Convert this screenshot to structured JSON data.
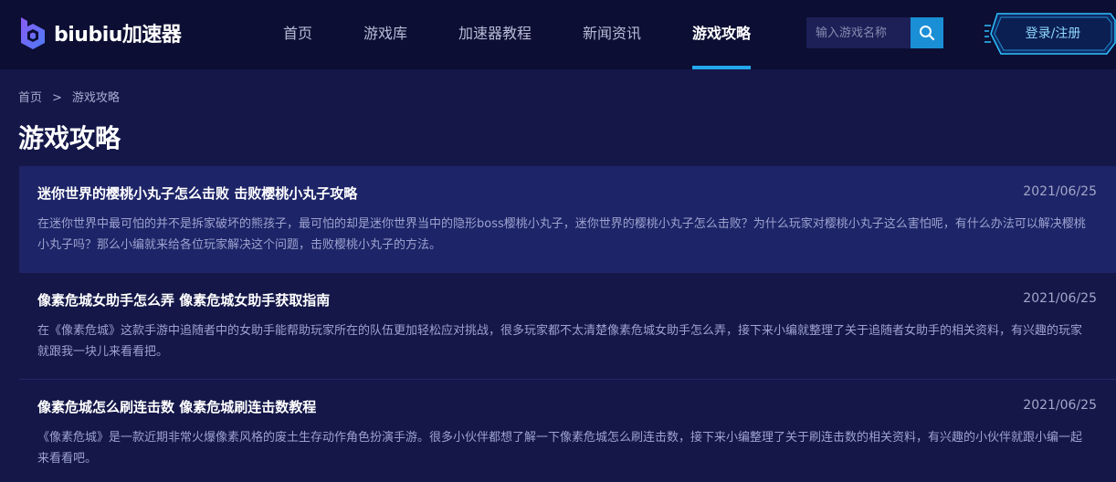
{
  "brand": {
    "logo_text": "biubiu加速器"
  },
  "nav": {
    "items": [
      {
        "label": "首页"
      },
      {
        "label": "游戏库"
      },
      {
        "label": "加速器教程"
      },
      {
        "label": "新闻资讯"
      },
      {
        "label": "游戏攻略",
        "active": true
      }
    ]
  },
  "search": {
    "placeholder": "输入游戏名称",
    "icon": "search-icon"
  },
  "auth": {
    "login_label": "登录/注册"
  },
  "breadcrumb": {
    "items": [
      "首页",
      "游戏攻略"
    ],
    "separator": ">"
  },
  "page": {
    "title": "游戏攻略"
  },
  "articles": [
    {
      "title": "迷你世界的樱桃小丸子怎么击败 击败樱桃小丸子攻略",
      "date": "2021/06/25",
      "summary": "在迷你世界中最可怕的并不是拆家破坏的熊孩子，最可怕的却是迷你世界当中的隐形boss樱桃小丸子，迷你世界的樱桃小丸子怎么击败？为什么玩家对樱桃小丸子这么害怕呢，有什么办法可以解决樱桃小丸子吗？那么小编就来给各位玩家解决这个问题，击败樱桃小丸子的方法。"
    },
    {
      "title": "像素危城女助手怎么弄 像素危城女助手获取指南",
      "date": "2021/06/25",
      "summary": "在《像素危城》这款手游中追随者中的女助手能帮助玩家所在的队伍更加轻松应对挑战，很多玩家都不太清楚像素危城女助手怎么弄，接下来小编就整理了关于追随者女助手的相关资料，有兴趣的玩家就跟我一块儿来看看把。"
    },
    {
      "title": "像素危城怎么刷连击数 像素危城刷连击数教程",
      "date": "2021/06/25",
      "summary": "《像素危城》是一款近期非常火爆像素风格的废土生存动作角色扮演手游。很多小伙伴都想了解一下像素危城怎么刷连击数，接下来小编整理了关于刷连击数的相关资料，有兴趣的小伙伴就跟小编一起来看看吧。"
    }
  ],
  "colors": {
    "header_bg": "#0c0e33",
    "page_bg": "#141748",
    "highlight_bg": "#1d2467",
    "accent": "#24a7ec",
    "search_button": "#1b8fd6"
  }
}
